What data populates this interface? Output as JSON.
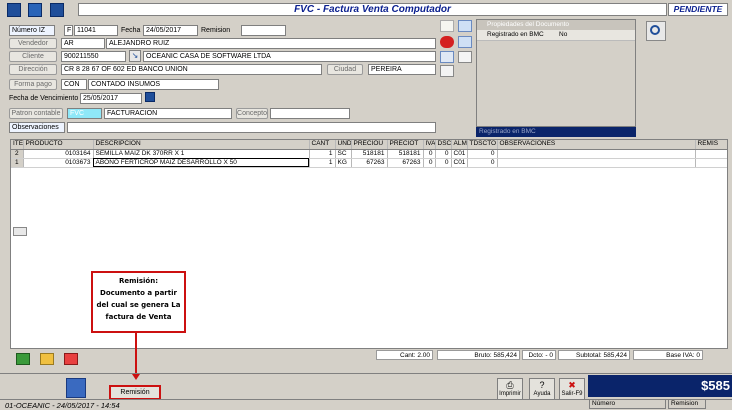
{
  "window": {
    "title": "FVC - Factura Venta Computador",
    "status": "PENDIENTE"
  },
  "form": {
    "numero_label": "Número IZ",
    "numero_prefix": "F",
    "numero_value": "11041",
    "fecha_label": "Fecha",
    "fecha_value": "24/05/2017",
    "remision_label": "Remision",
    "remision_value": "",
    "vendedor_label": "Vendedor",
    "vendedor_code": "AR",
    "vendedor_name": "ALEJANDRO RUIZ",
    "cliente_label": "Cliente",
    "cliente_code": "900211550",
    "cliente_name": "OCEANIC CASA DE SOFTWARE LTDA",
    "direccion_label": "Dirección",
    "direccion_value": "CR 8 28 67 OF 602 ED BANCO UNION",
    "ciudad_label": "Ciudad",
    "ciudad_value": "PEREIRA",
    "formapago_label": "Forma pago",
    "formapago_code": "CON",
    "formapago_name": "CONTADO INSUMOS",
    "vencimiento_label": "Fecha de Vencimiento",
    "vencimiento_value": "25/05/2017",
    "patron_label": "Patron contable",
    "patron_code": "FVC",
    "patron_name": "FACTURACION",
    "concepto_label": "Concepto",
    "concepto_value": "",
    "observaciones_label": "Observaciones",
    "observaciones_value": ""
  },
  "properties": {
    "header": "Propiedades del Documento",
    "row_label": "Registrado en BMC",
    "row_value": "No",
    "footer": "Registrado en BMC"
  },
  "grid": {
    "columns": [
      "ITE",
      "PRODUCTO",
      "DESCRIPCION",
      "CANT",
      "UND",
      "PRECIOU",
      "PRECIOT",
      "IVA",
      "DSCT",
      "ALM",
      "TDSCTO",
      "OBSERVACIONES",
      "REMIS"
    ],
    "rows": [
      [
        "2",
        "0103164",
        "SEMILLA MAIZ DK 370RR  X 1",
        "1",
        "SC",
        "518181",
        "518181",
        "0",
        "0",
        "C01",
        "0",
        "",
        ""
      ],
      [
        "1",
        "0103673",
        "ABONO FERTICROP MAIZ DESARROLLO X 50",
        "1",
        "KG",
        "67263",
        "67263",
        "0",
        "0",
        "C01",
        "0",
        "",
        ""
      ]
    ]
  },
  "annotation": {
    "text": "Remisión: Documento a partir del cual se genera La factura de Venta"
  },
  "totals": {
    "cant": "Cant: 2.00",
    "bruto": "Bruto: 585,424",
    "dcto": "Dcto: - 0",
    "subtotal": "Subtotal: 585,424",
    "base_iva": "Base IVA: 0"
  },
  "bottom": {
    "remision_button": "Remisión",
    "imprimir": "Imprimir",
    "ayuda": "Ayuda",
    "salir": "Salir-F9",
    "big_total": "$585",
    "status_text": "01-OCEANIC - 24/05/2017 - 14:54",
    "numero_label": "Número",
    "remision_label": "Remision"
  },
  "colors": {
    "title_text": "#0a1f8f",
    "title_bg": "#ffffff",
    "annotation_red": "#cc1010",
    "properties_footer": "#0a246a"
  }
}
